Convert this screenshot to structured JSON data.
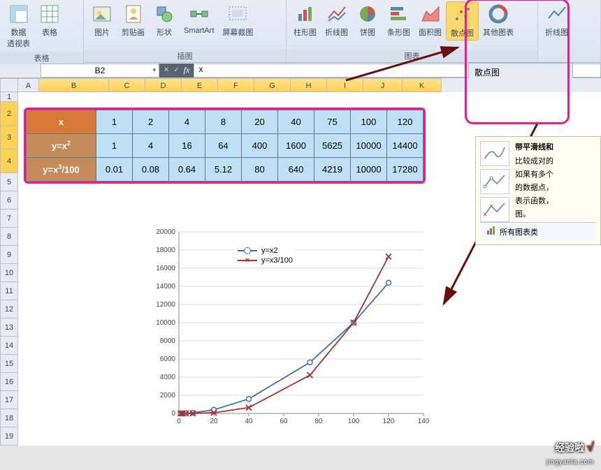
{
  "ribbon": {
    "groups": [
      {
        "label": "表格",
        "items": [
          "数据\n透视表",
          "表格"
        ]
      },
      {
        "label": "插图",
        "items": [
          "图片",
          "剪贴画",
          "形状",
          "SmartArt",
          "屏幕截图"
        ]
      },
      {
        "label": "图表",
        "items": [
          "柱形图",
          "折线图",
          "饼图",
          "条形图",
          "面积图",
          "散点图",
          "其他图表"
        ]
      }
    ],
    "extra_items": [
      "折线图"
    ]
  },
  "scatter_panel": {
    "title": "散点图"
  },
  "tooltip": {
    "title": "带平滑线和",
    "line1": "比较成对的",
    "line2": "如果有多个",
    "line3": "的数据点，",
    "line4": "表示函数，",
    "line5": "图。",
    "all_charts": "所有图表类"
  },
  "namebox": "B2",
  "formula": "x",
  "columns": [
    "A",
    "B",
    "C",
    "D",
    "E",
    "F",
    "G",
    "H",
    "I",
    "J",
    "K"
  ],
  "col_widths": {
    "A": 30,
    "B": 100,
    "C": 52,
    "D": 52,
    "E": 52,
    "F": 52,
    "G": 52,
    "H": 52,
    "I": 52,
    "J": 56,
    "K": 56
  },
  "rows": [
    1,
    2,
    3,
    4,
    5,
    6,
    7,
    8,
    9,
    10,
    11,
    12,
    13,
    14,
    15,
    16,
    17,
    18,
    19
  ],
  "row_heights": {
    "1": 14,
    "2": 34,
    "3": 34,
    "4": 34
  },
  "table": {
    "headers": [
      "x",
      "y=x²",
      "y=x³/100"
    ],
    "x": [
      1,
      2,
      4,
      8,
      20,
      40,
      75,
      100,
      120
    ],
    "y1": [
      1,
      4,
      16,
      64,
      400,
      1600,
      5625,
      10000,
      14400
    ],
    "y2": [
      0.01,
      0.08,
      0.64,
      5.12,
      80,
      640,
      4219,
      10000,
      17280
    ]
  },
  "chart_data": {
    "type": "line",
    "x": [
      1,
      2,
      4,
      8,
      20,
      40,
      75,
      100,
      120
    ],
    "series": [
      {
        "name": "y=x2",
        "values": [
          1,
          4,
          16,
          64,
          400,
          1600,
          5625,
          10000,
          14400
        ],
        "color": "#3d70b8",
        "marker": "circle"
      },
      {
        "name": "y=x3/100",
        "values": [
          0.01,
          0.08,
          0.64,
          5.12,
          80,
          640,
          4219,
          10000,
          17280
        ],
        "color": "#a83232",
        "marker": "x"
      }
    ],
    "xlim": [
      0,
      140
    ],
    "ylim": [
      0,
      20000
    ],
    "xticks": [
      0,
      20,
      40,
      60,
      80,
      100,
      120,
      140
    ],
    "yticks": [
      0,
      2000,
      4000,
      6000,
      8000,
      10000,
      12000,
      14000,
      16000,
      18000,
      20000
    ]
  },
  "watermark": {
    "main": "经验啦",
    "sub": "jingyanla.com"
  }
}
